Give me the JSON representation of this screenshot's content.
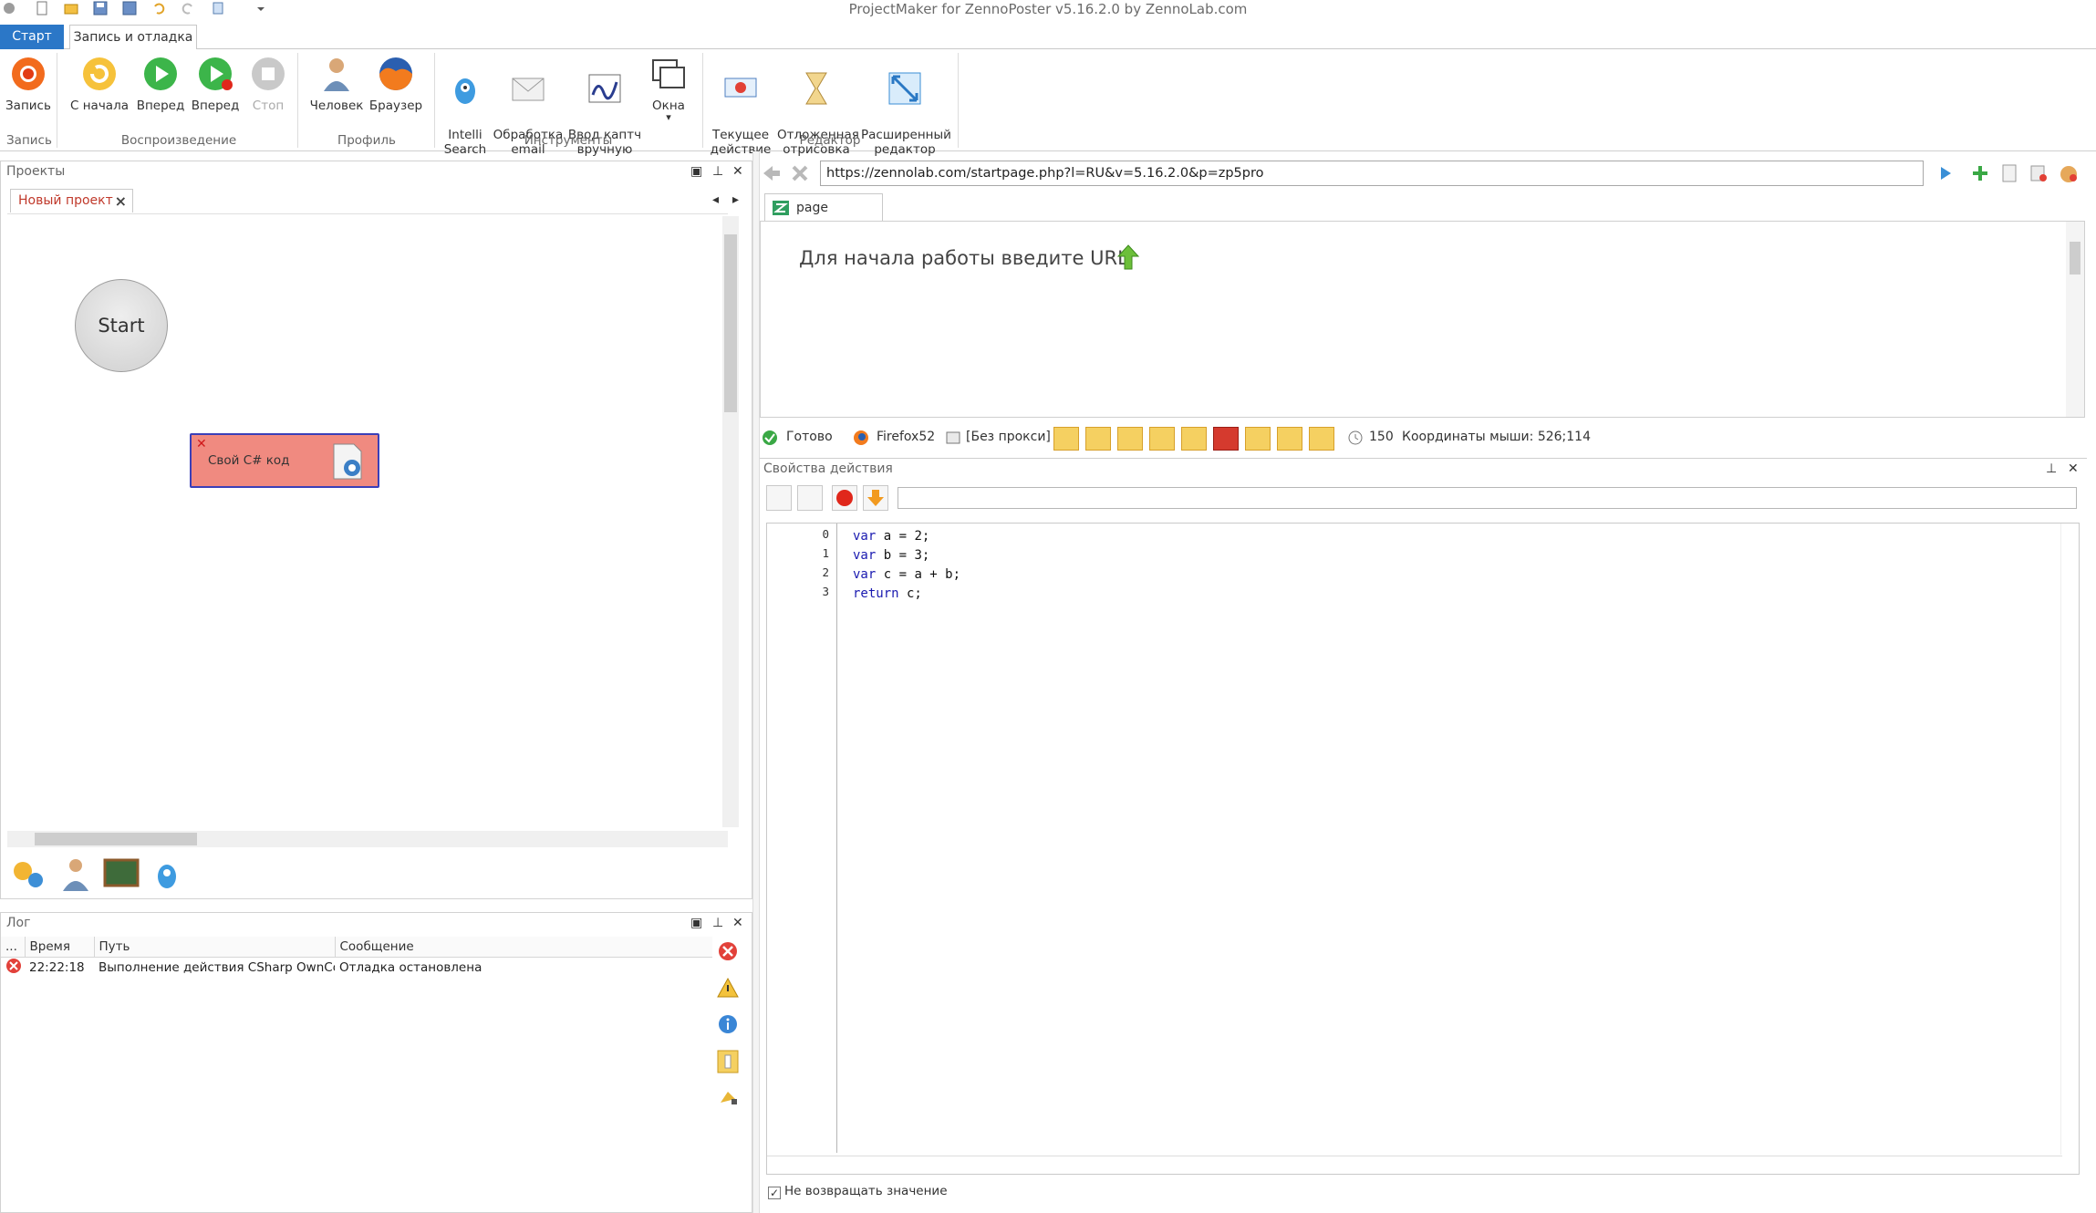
{
  "window": {
    "title": "ProjectMaker for ZennoPoster v5.16.2.0 by ZennoLab.com"
  },
  "ribbon": {
    "tabs": [
      {
        "label": "Старт"
      },
      {
        "label": "Запись и отладка"
      }
    ],
    "buttons": {
      "record": "Запись",
      "from_start": "С начала",
      "forward1": "Вперед",
      "forward2": "Вперед",
      "stop": "Стоп",
      "human": "Человек",
      "browser": "Браузер",
      "intelli": "Intelli\nSearch",
      "email": "Обработка\nemail",
      "captcha": "Ввод каптч\nвручную",
      "windows": "Окна",
      "current_action": "Текущее\nдействие",
      "deferred": "Отложенная\nотрисовка",
      "ext_editor": "Расширенный\nредактор"
    },
    "groups": {
      "record": "Запись",
      "playback": "Воспроизведение",
      "profile": "Профиль",
      "tools": "Инструменты",
      "editor": "Редактор"
    }
  },
  "projects": {
    "title": "Проекты",
    "doc_tab": "Новый проект",
    "start_node": "Start",
    "cs_node": "Свой C# код"
  },
  "log": {
    "title": "Лог",
    "columns": [
      "...",
      "Время",
      "Путь",
      "Сообщение"
    ],
    "rows": [
      {
        "time": "22:22:18",
        "path": "Выполнение действия CSharp OwnCo...",
        "message": "Отладка остановлена"
      }
    ]
  },
  "browser": {
    "url": "https://zennolab.com/startpage.php?l=RU&v=5.16.2.0&p=zp5pro",
    "tab": "page",
    "message": "Для начала работы введите URL"
  },
  "status": {
    "ready": "Готово",
    "engine": "Firefox52",
    "proxy": "[Без прокси]",
    "timer": "150",
    "mouse": "Координаты мыши: 526;114"
  },
  "props": {
    "title": "Свойства действия",
    "code_lines": [
      {
        "n": "0",
        "kw": "var",
        "rest": " a = 2;"
      },
      {
        "n": "1",
        "kw": "var",
        "rest": " b = 3;"
      },
      {
        "n": "2",
        "kw": "var",
        "rest": " c = a + b;"
      },
      {
        "n": "3",
        "kw": "return",
        "rest": " c;"
      }
    ],
    "no_return_label": "Не возвращать значение"
  }
}
